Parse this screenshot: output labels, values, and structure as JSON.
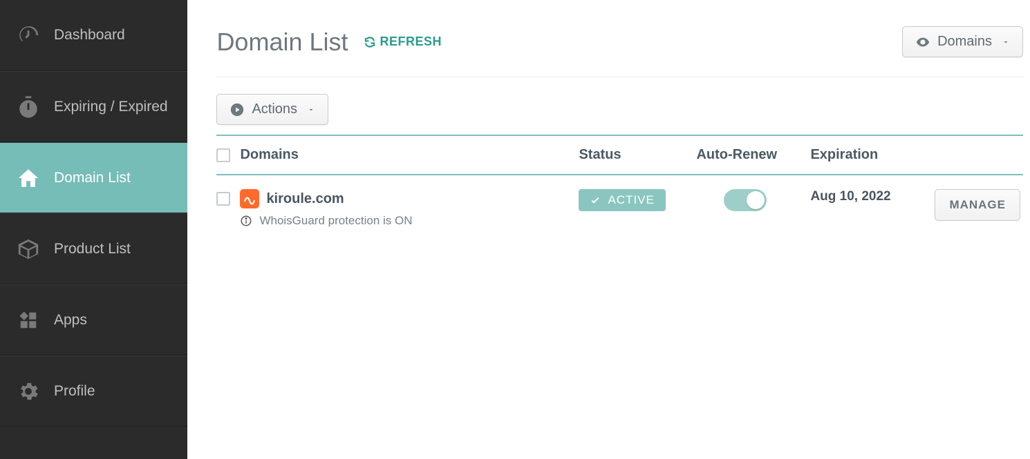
{
  "sidebar": {
    "items": [
      {
        "label": "Dashboard"
      },
      {
        "label": "Expiring / Expired"
      },
      {
        "label": "Domain List"
      },
      {
        "label": "Product List"
      },
      {
        "label": "Apps"
      },
      {
        "label": "Profile"
      }
    ]
  },
  "header": {
    "title": "Domain List",
    "refresh_label": "REFRESH",
    "domains_dropdown_label": "Domains"
  },
  "actions": {
    "actions_label": "Actions"
  },
  "table": {
    "columns": {
      "domains": "Domains",
      "status": "Status",
      "auto_renew": "Auto-Renew",
      "expiration": "Expiration"
    },
    "rows": [
      {
        "domain": "kiroule.com",
        "whois_text": "WhoisGuard protection is ON",
        "status_label": "ACTIVE",
        "auto_renew": true,
        "expiration": "Aug 10, 2022",
        "manage_label": "MANAGE"
      }
    ]
  }
}
